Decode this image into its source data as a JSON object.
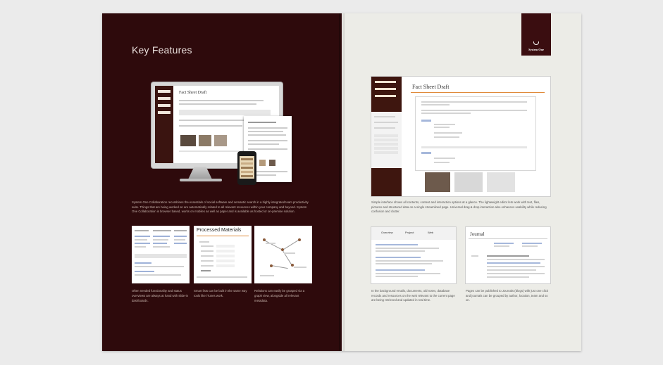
{
  "left_page": {
    "heading": "Key Features",
    "hero": {
      "monitor_doc_title": "Fact Sheet Draft"
    },
    "caption": "System One Collaboration recombines the essentials of social software and semantic search in a highly integrated team productivity suite. Things that are being worked on are automatically related to all relevant resources within your company and beyond. System One Collaboration is browser based, works on mobiles as well as paper and is available as hosted or on-premise solution.",
    "thumbnails": [
      {
        "title": "",
        "caption": "Often needed functionality and status overviews are always at hand with slide-in dashboards."
      },
      {
        "title": "Processed Materials",
        "caption": "Smart lists can be built in the same way tools like iTunes work."
      },
      {
        "title": "",
        "caption": "Relations can easily be grasped via a graph view, alongside all relevant metadata."
      }
    ]
  },
  "right_page": {
    "logo_text": "System One",
    "main_screenshot": {
      "doc_title": "Fact Sheet Draft"
    },
    "main_caption": "Simple interface shows all contents, context and interaction options at a glance. The lightweight editor lets work with text, files, pictures and structured data on a single streamlined page. Universal drag & drop interaction also enhances usability while reducing confusion and clutter.",
    "bottom_left": {
      "tabs": [
        "Overview",
        "Project",
        "Web"
      ],
      "caption": "In the background emails, documents, old notes, database records and resources on the web relevant to the current page are being retrieved and updated in real time."
    },
    "bottom_right": {
      "title": "Journal",
      "caption": "Pages can be published to Journals (blogs) with just one click and journals can be grouped by author, location, team and so on."
    }
  }
}
